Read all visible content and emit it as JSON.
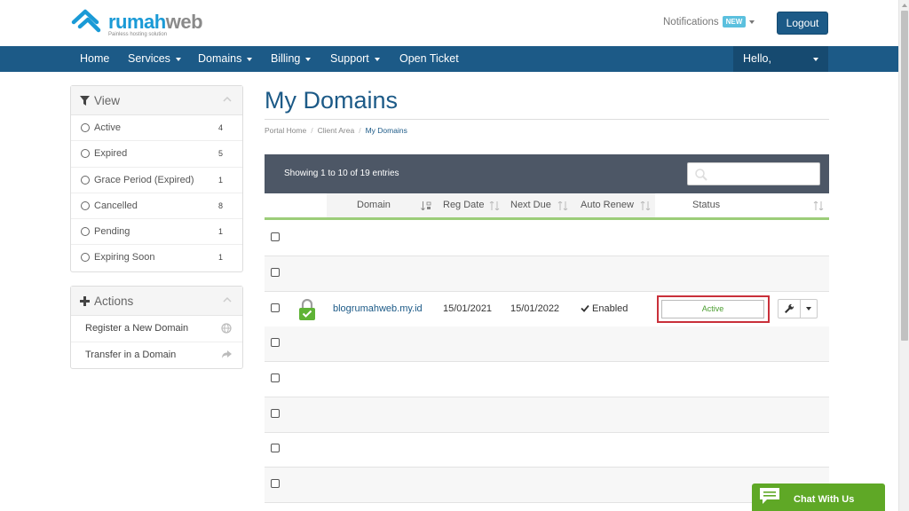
{
  "header": {
    "logo_main_a": "rumah",
    "logo_main_b": "web",
    "logo_tagline": "Painless hosting solution",
    "notifications_label": "Notifications",
    "notifications_badge": "NEW",
    "logout_label": "Logout"
  },
  "nav": {
    "items": [
      {
        "label": "Home"
      },
      {
        "label": "Services"
      },
      {
        "label": "Domains"
      },
      {
        "label": "Billing"
      },
      {
        "label": "Support"
      },
      {
        "label": "Open Ticket"
      }
    ],
    "hello_label": "Hello,"
  },
  "sidebar": {
    "view_title": "View",
    "filters": [
      {
        "label": "Active",
        "count": "4"
      },
      {
        "label": "Expired",
        "count": "5"
      },
      {
        "label": "Grace Period (Expired)",
        "count": "1"
      },
      {
        "label": "Cancelled",
        "count": "8"
      },
      {
        "label": "Pending",
        "count": "1"
      },
      {
        "label": "Expiring Soon",
        "count": "1"
      }
    ],
    "actions_title": "Actions",
    "actions": [
      {
        "label": "Register a New Domain",
        "icon": "globe-icon"
      },
      {
        "label": "Transfer in a Domain",
        "icon": "share-arrow-icon"
      }
    ]
  },
  "main": {
    "title": "My Domains",
    "breadcrumb": [
      "Portal Home",
      "Client Area",
      "My Domains"
    ],
    "showing_text": "Showing 1 to 10 of 19 entries",
    "columns": [
      "Domain",
      "Reg Date",
      "Next Due",
      "Auto Renew",
      "Status"
    ],
    "rows": [
      {
        "domain": "",
        "reg_date": "",
        "next_due": "",
        "auto_renew": "",
        "status": ""
      },
      {
        "domain": "",
        "reg_date": "",
        "next_due": "",
        "auto_renew": "",
        "status": ""
      },
      {
        "domain": "blogrumahweb.my.id",
        "reg_date": "15/01/2021",
        "next_due": "15/01/2022",
        "auto_renew": "Enabled",
        "status": "Active"
      },
      {
        "domain": "",
        "reg_date": "",
        "next_due": "",
        "auto_renew": "",
        "status": ""
      },
      {
        "domain": "",
        "reg_date": "",
        "next_due": "",
        "auto_renew": "",
        "status": ""
      },
      {
        "domain": "",
        "reg_date": "",
        "next_due": "",
        "auto_renew": "",
        "status": ""
      },
      {
        "domain": "",
        "reg_date": "",
        "next_due": "",
        "auto_renew": "",
        "status": ""
      },
      {
        "domain": "",
        "reg_date": "",
        "next_due": "",
        "auto_renew": "",
        "status": ""
      }
    ]
  },
  "chat": {
    "label": "Chat With Us"
  },
  "colors": {
    "brand": "#1c5a87",
    "accent_green": "#5fa826",
    "status_active": "#4a9d2f",
    "highlight_red": "#c9303a"
  }
}
